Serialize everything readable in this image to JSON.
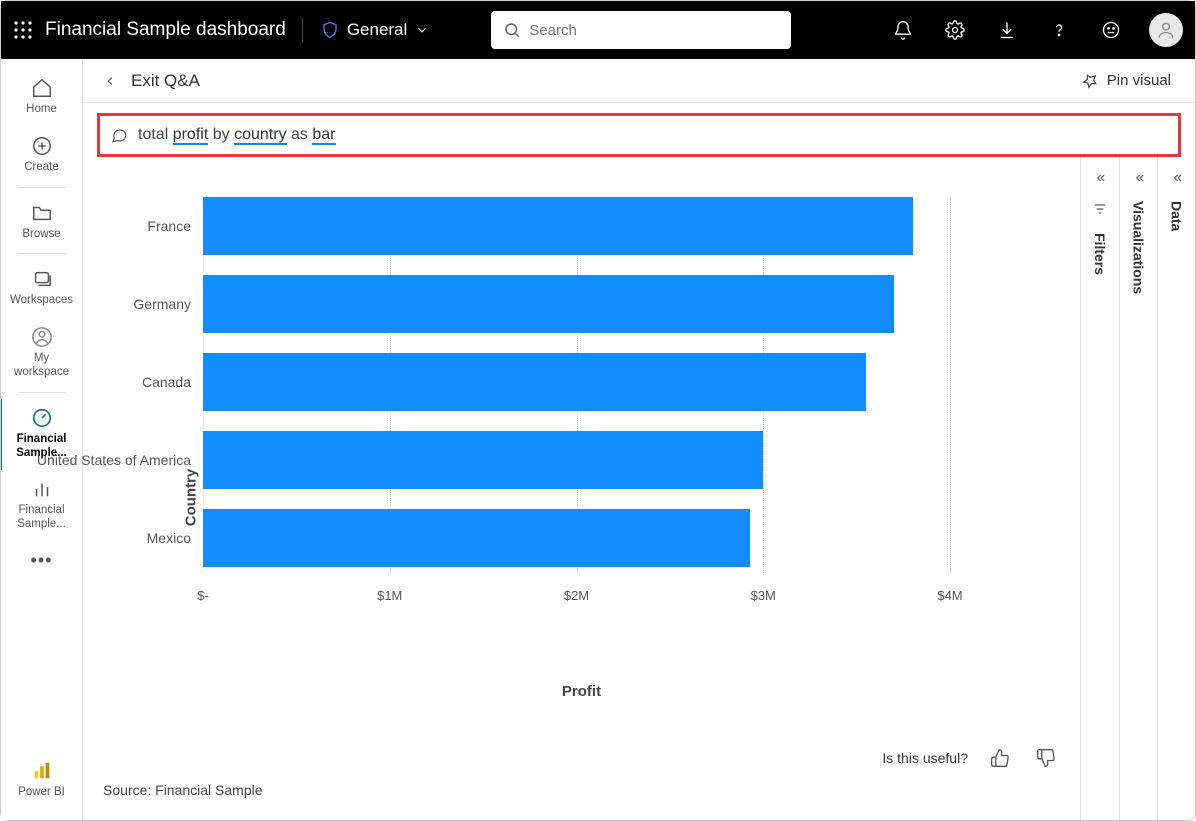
{
  "header": {
    "title": "Financial Sample dashboard",
    "sensitivity_label": "General",
    "search_placeholder": "Search"
  },
  "leftnav": {
    "items": [
      {
        "icon": "home",
        "label": "Home"
      },
      {
        "icon": "plus-circle",
        "label": "Create"
      },
      {
        "icon": "folder",
        "label": "Browse"
      },
      {
        "icon": "stack",
        "label": "Workspaces"
      },
      {
        "icon": "user-circle",
        "label": "My workspace"
      },
      {
        "icon": "gauge",
        "label": "Financial Sample..."
      },
      {
        "icon": "bars",
        "label": "Financial Sample..."
      }
    ],
    "footer_label": "Power BI"
  },
  "subheader": {
    "exit_label": "Exit Q&A",
    "pin_label": "Pin visual"
  },
  "qna": {
    "tokens": [
      "total",
      "profit",
      "by",
      "country",
      "as",
      "bar"
    ],
    "underlined": [
      false,
      true,
      false,
      true,
      false,
      true
    ]
  },
  "chart_data": {
    "type": "bar",
    "orientation": "horizontal",
    "ylabel": "Country",
    "xlabel": "Profit",
    "xlim": [
      0,
      4000000
    ],
    "xticks": [
      "$-",
      "$1M",
      "$2M",
      "$3M",
      "$4M"
    ],
    "categories": [
      "France",
      "Germany",
      "Canada",
      "United States of America",
      "Mexico"
    ],
    "values": [
      3800000,
      3700000,
      3550000,
      3000000,
      2930000
    ],
    "source": "Source: Financial Sample",
    "feedback_prompt": "Is this useful?"
  },
  "panels": {
    "filters": "Filters",
    "visualizations": "Visualizations",
    "data": "Data"
  }
}
